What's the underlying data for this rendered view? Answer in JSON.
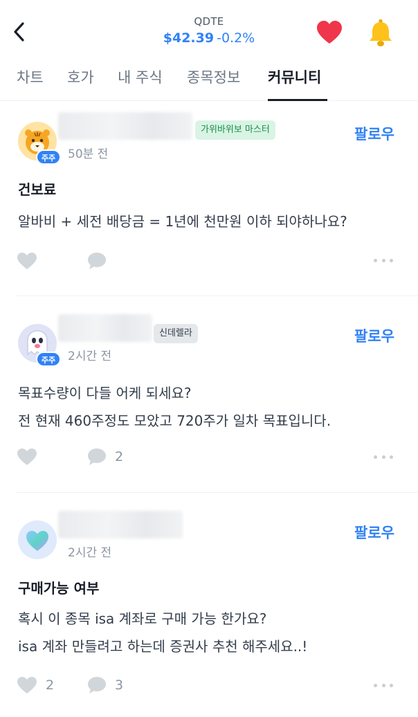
{
  "header": {
    "ticker": "QDTE",
    "price": "$42.39",
    "change": "-0.2%",
    "back_icon": "chevron-left-icon",
    "heart_icon": "heart-icon",
    "bell_icon": "bell-icon"
  },
  "tabs": [
    {
      "label": "차트",
      "active": false
    },
    {
      "label": "호가",
      "active": false
    },
    {
      "label": "내 주식",
      "active": false
    },
    {
      "label": "종목정보",
      "active": false
    },
    {
      "label": "커뮤니티",
      "active": true
    }
  ],
  "colors": {
    "accent": "#3182f6",
    "heart": "#f0364a",
    "bell": "#ffc21a",
    "tag_green_bg": "#d9f4e4",
    "tag_green_text": "#1a8c4d"
  },
  "posts": [
    {
      "badge": "주주",
      "tag": "가위바위보 마스터",
      "time": "50분 전",
      "follow": "팔로우",
      "title": "건보료",
      "body": [
        "알바비 + 세전 배당금 = 1년에 천만원 이하 되야하나요?"
      ],
      "likes": "",
      "comments": ""
    },
    {
      "badge": "주주",
      "tag": "신데렐라",
      "time": "2시간 전",
      "follow": "팔로우",
      "title": "",
      "body": [
        "목표수량이 다들 어케 되세요?",
        "전 현재 460주정도 모았고 720주가 일차 목표입니다."
      ],
      "likes": "",
      "comments": "2"
    },
    {
      "badge": "",
      "tag": "",
      "time": "2시간 전",
      "follow": "팔로우",
      "title": "구매가능 여부",
      "body": [
        "혹시 이 종목 isa 계좌로 구매 가능 한가요?",
        "isa 계좌 만들려고 하는데 증권사 추천 해주세요..!"
      ],
      "likes": "2",
      "comments": "3"
    }
  ]
}
